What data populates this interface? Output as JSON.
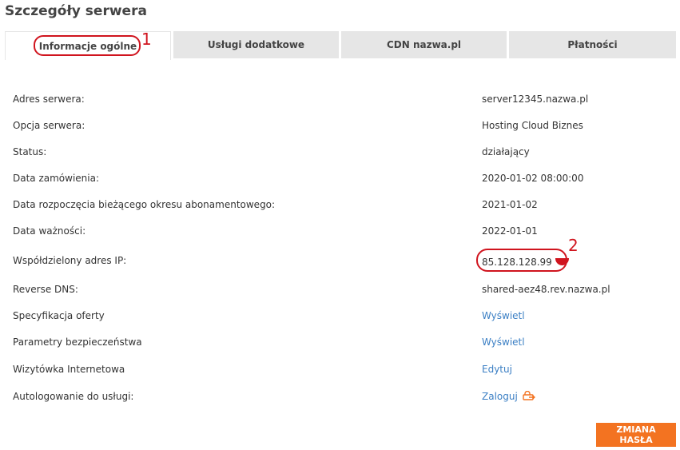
{
  "page": {
    "title": "Szczegóły serwera"
  },
  "tabs": [
    {
      "label": "Informacje ogólne",
      "active": true
    },
    {
      "label": "Usługi dodatkowe"
    },
    {
      "label": "CDN nazwa.pl"
    },
    {
      "label": "Płatności"
    }
  ],
  "annotations": [
    "1",
    "2"
  ],
  "details": [
    {
      "label": "Adres serwera:",
      "value": "server12345.nazwa.pl"
    },
    {
      "label": "Opcja serwera:",
      "value": "Hosting Cloud Biznes"
    },
    {
      "label": "Status:",
      "value": "działający"
    },
    {
      "label": "Data zamówienia:",
      "value": "2020-01-02 08:00:00"
    },
    {
      "label": "Data rozpoczęcia bieżącego okresu abonamentowego:",
      "value": "2021-01-02"
    },
    {
      "label": "Data ważności:",
      "value": "2022-01-01"
    },
    {
      "label": "Współdzielony adres IP:",
      "value": "85.128.128.99",
      "icon": "poland-flag-icon"
    },
    {
      "label": "Reverse DNS:",
      "value": "shared-aez48.rev.nazwa.pl"
    },
    {
      "label": "Specyfikacja oferty",
      "link": "Wyświetl"
    },
    {
      "label": "Parametry bezpieczeństwa",
      "link": "Wyświetl"
    },
    {
      "label": "Wizytówka Internetowa",
      "link": "Edytuj"
    },
    {
      "label": "Autologowanie do usługi:",
      "link": "Zaloguj",
      "icon": "login-icon"
    }
  ],
  "actions": {
    "change_password": "ZMIANA HASŁA"
  },
  "colors": {
    "accent": "#f37321",
    "link": "#3b7fc4",
    "annotation": "#d0141e",
    "tab_bg": "#e6e6e6"
  }
}
